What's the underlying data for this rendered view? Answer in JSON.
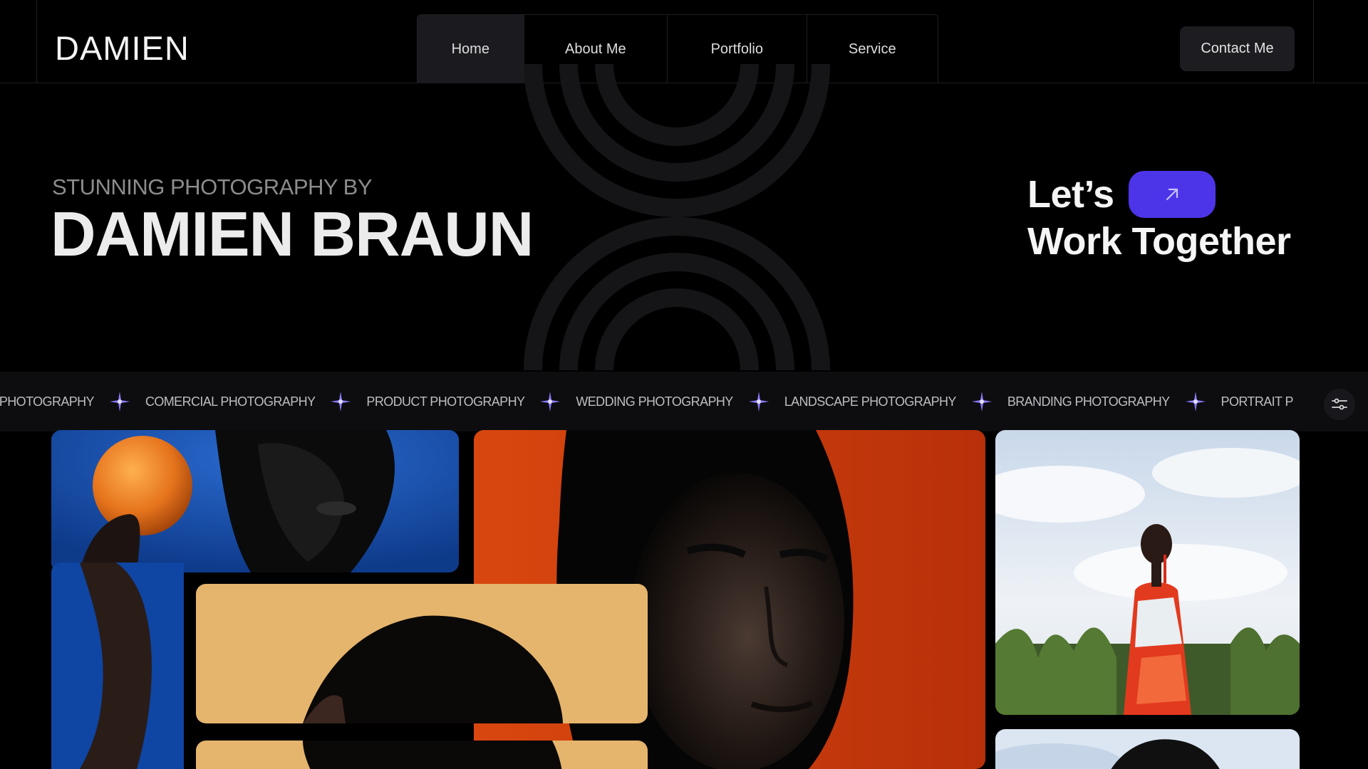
{
  "nav": {
    "logo": "DAMIEN",
    "items": [
      {
        "label": "Home",
        "active": true
      },
      {
        "label": "About Me",
        "active": false
      },
      {
        "label": "Portfolio",
        "active": false
      },
      {
        "label": "Service",
        "active": false
      }
    ],
    "contact_label": "Contact Me"
  },
  "hero": {
    "kicker": "STUNNING PHOTOGRAPHY BY",
    "name": "DAMIEN BRAUN",
    "cta_line1": "Let’s",
    "cta_line2": "Work Together",
    "cta_icon": "arrow-up-right-icon"
  },
  "marquee": {
    "items": [
      "NT PHOTOGRAPHY",
      "COMERCIAL PHOTOGRAPHY",
      "PRODUCT PHOTOGRAPHY",
      "WEDDING PHOTOGRAPHY",
      "LANDSCAPE PHOTOGRAPHY",
      "BRANDING PHOTOGRAPHY",
      "PORTRAIT P"
    ],
    "separator_icon": "sparkle-icon",
    "filter_icon": "filter-icon"
  },
  "colors": {
    "accent": "#4c35e8",
    "sparkle": "#8b7bff",
    "background": "#000000",
    "surface": "#0d0d10"
  }
}
